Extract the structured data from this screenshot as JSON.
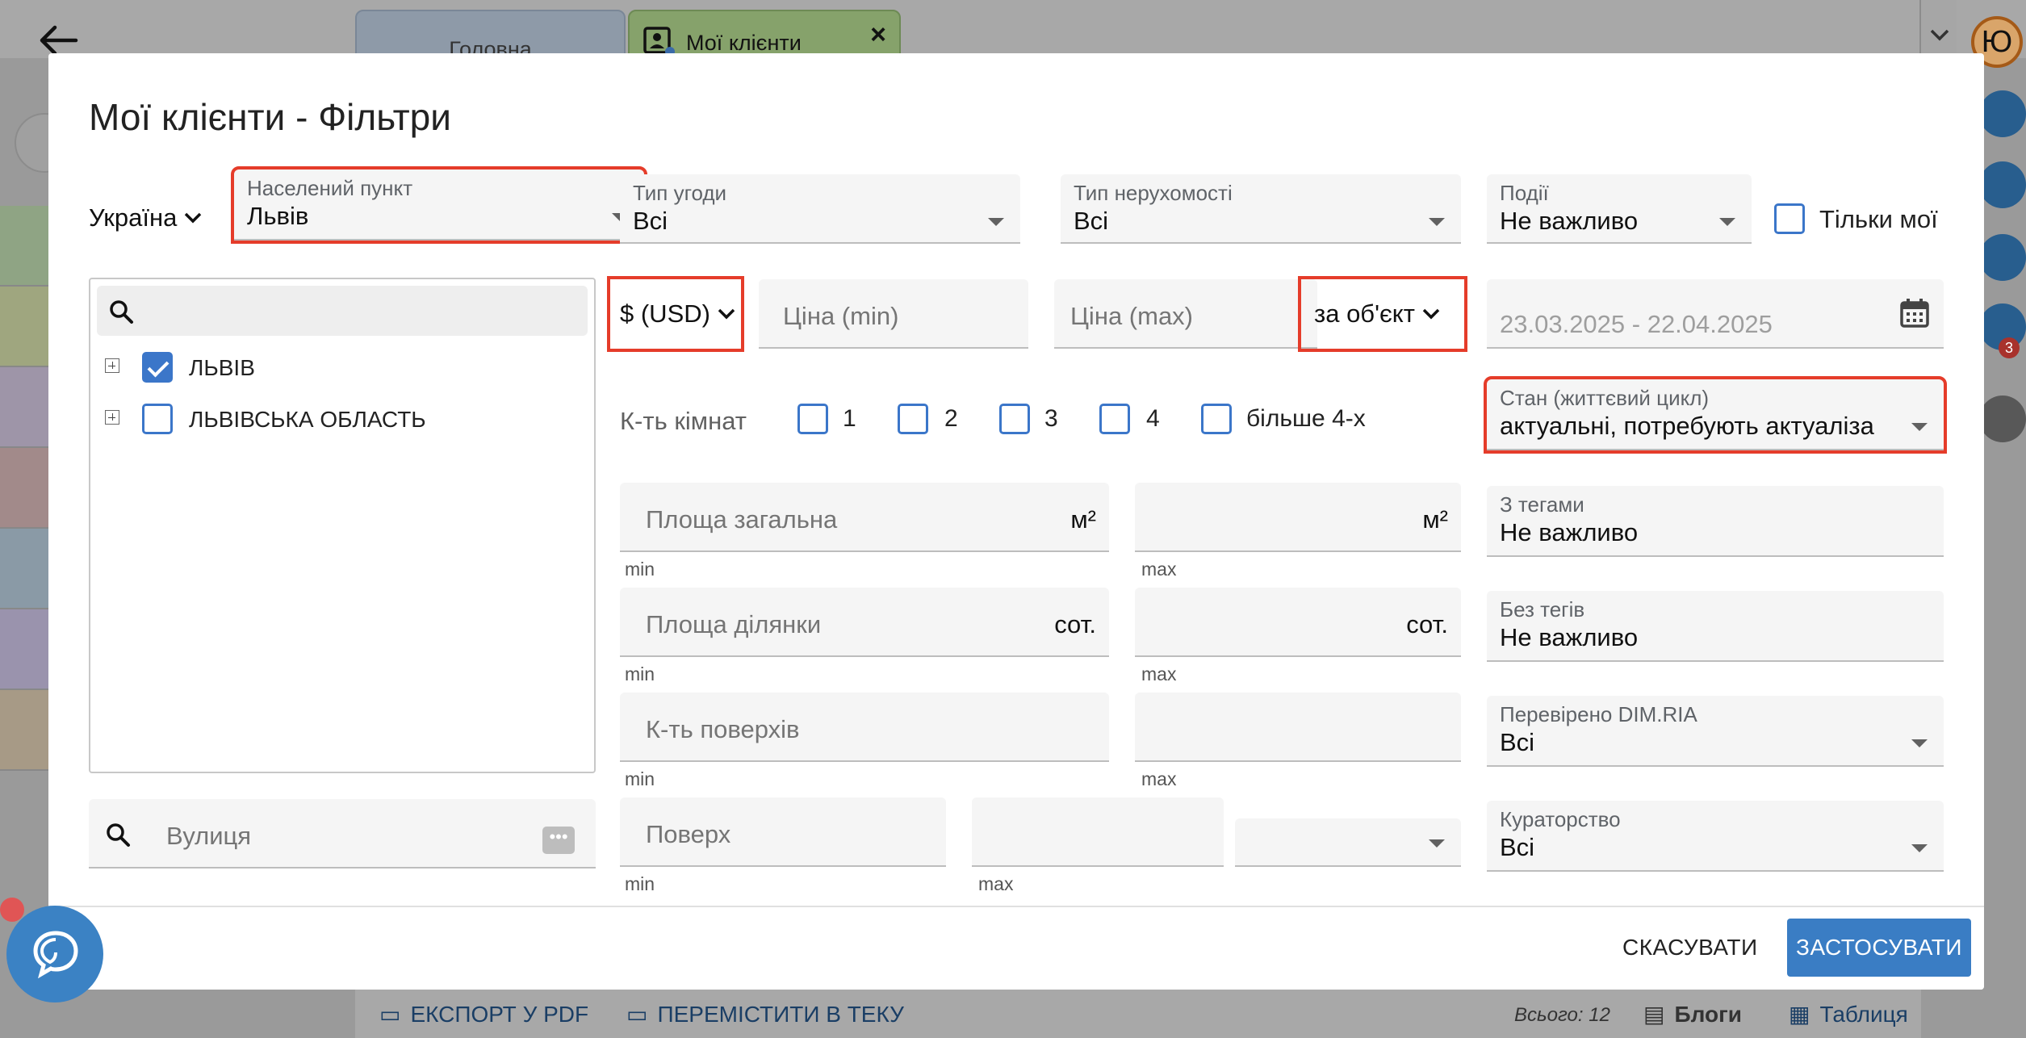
{
  "background": {
    "tabs": [
      {
        "label": "Головна"
      },
      {
        "label": "Мої клієнти"
      }
    ],
    "avatar_letter": "Ю",
    "notification_count": "3",
    "bottom_bar": {
      "export_pdf": "ЕКСПОРТ У PDF",
      "move_to_folder": "ПЕРЕМІСТИТИ В ТЕКУ",
      "total": "Всього: 12",
      "blogs": "Блоги",
      "table": "Таблиця"
    }
  },
  "modal": {
    "title": "Мої клієнти - Фільтри",
    "country": "Україна",
    "settlement": {
      "label": "Населений пункт",
      "value": "Львів"
    },
    "deal_type": {
      "label": "Тип угоди",
      "value": "Всі"
    },
    "property_type": {
      "label": "Тип нерухомості",
      "value": "Всі"
    },
    "events": {
      "label": "Події",
      "value": "Не важливо"
    },
    "only_mine": "Тільки мої",
    "currency": "$ (USD)",
    "price_min": "Ціна (min)",
    "price_max": "Ціна (max)",
    "price_per": "за об'єкт",
    "date_range": "23.03.2025 - 22.04.2025",
    "rooms": {
      "label": "К-ть кімнат",
      "options": [
        "1",
        "2",
        "3",
        "4",
        "більше 4-х"
      ]
    },
    "state": {
      "label": "Стан (життєвий цикл)",
      "value": "актуальні, потребують актуаліза"
    },
    "area_total": {
      "placeholder": "Площа загальна",
      "unit": "м²",
      "min": "min",
      "max": "max"
    },
    "area_plot": {
      "placeholder": "Площа ділянки",
      "unit": "сот.",
      "min": "min",
      "max": "max"
    },
    "floors_count": {
      "placeholder": "К-ть поверхів",
      "min": "min",
      "max": "max"
    },
    "floor": {
      "placeholder": "Поверх",
      "min": "min",
      "max": "max"
    },
    "with_tags": {
      "label": "З тегами",
      "value": "Не важливо"
    },
    "without_tags": {
      "label": "Без тегів",
      "value": "Не важливо"
    },
    "verified": {
      "label": "Перевірено DIM.RIA",
      "value": "Всі"
    },
    "curatorship": {
      "label": "Кураторство",
      "value": "Всі"
    },
    "tree": {
      "items": [
        {
          "label": "ЛЬВІВ",
          "checked": true
        },
        {
          "label": "ЛЬВІВСЬКА ОБЛАСТЬ",
          "checked": false
        }
      ]
    },
    "street_placeholder": "Вулиця",
    "cancel": "СКАСУВАТИ",
    "apply": "ЗАСТОСУВАТИ"
  },
  "colors": {
    "accent": "#3a7dc4",
    "highlight": "#e53c2a",
    "checkbox": "#3b76c9"
  }
}
